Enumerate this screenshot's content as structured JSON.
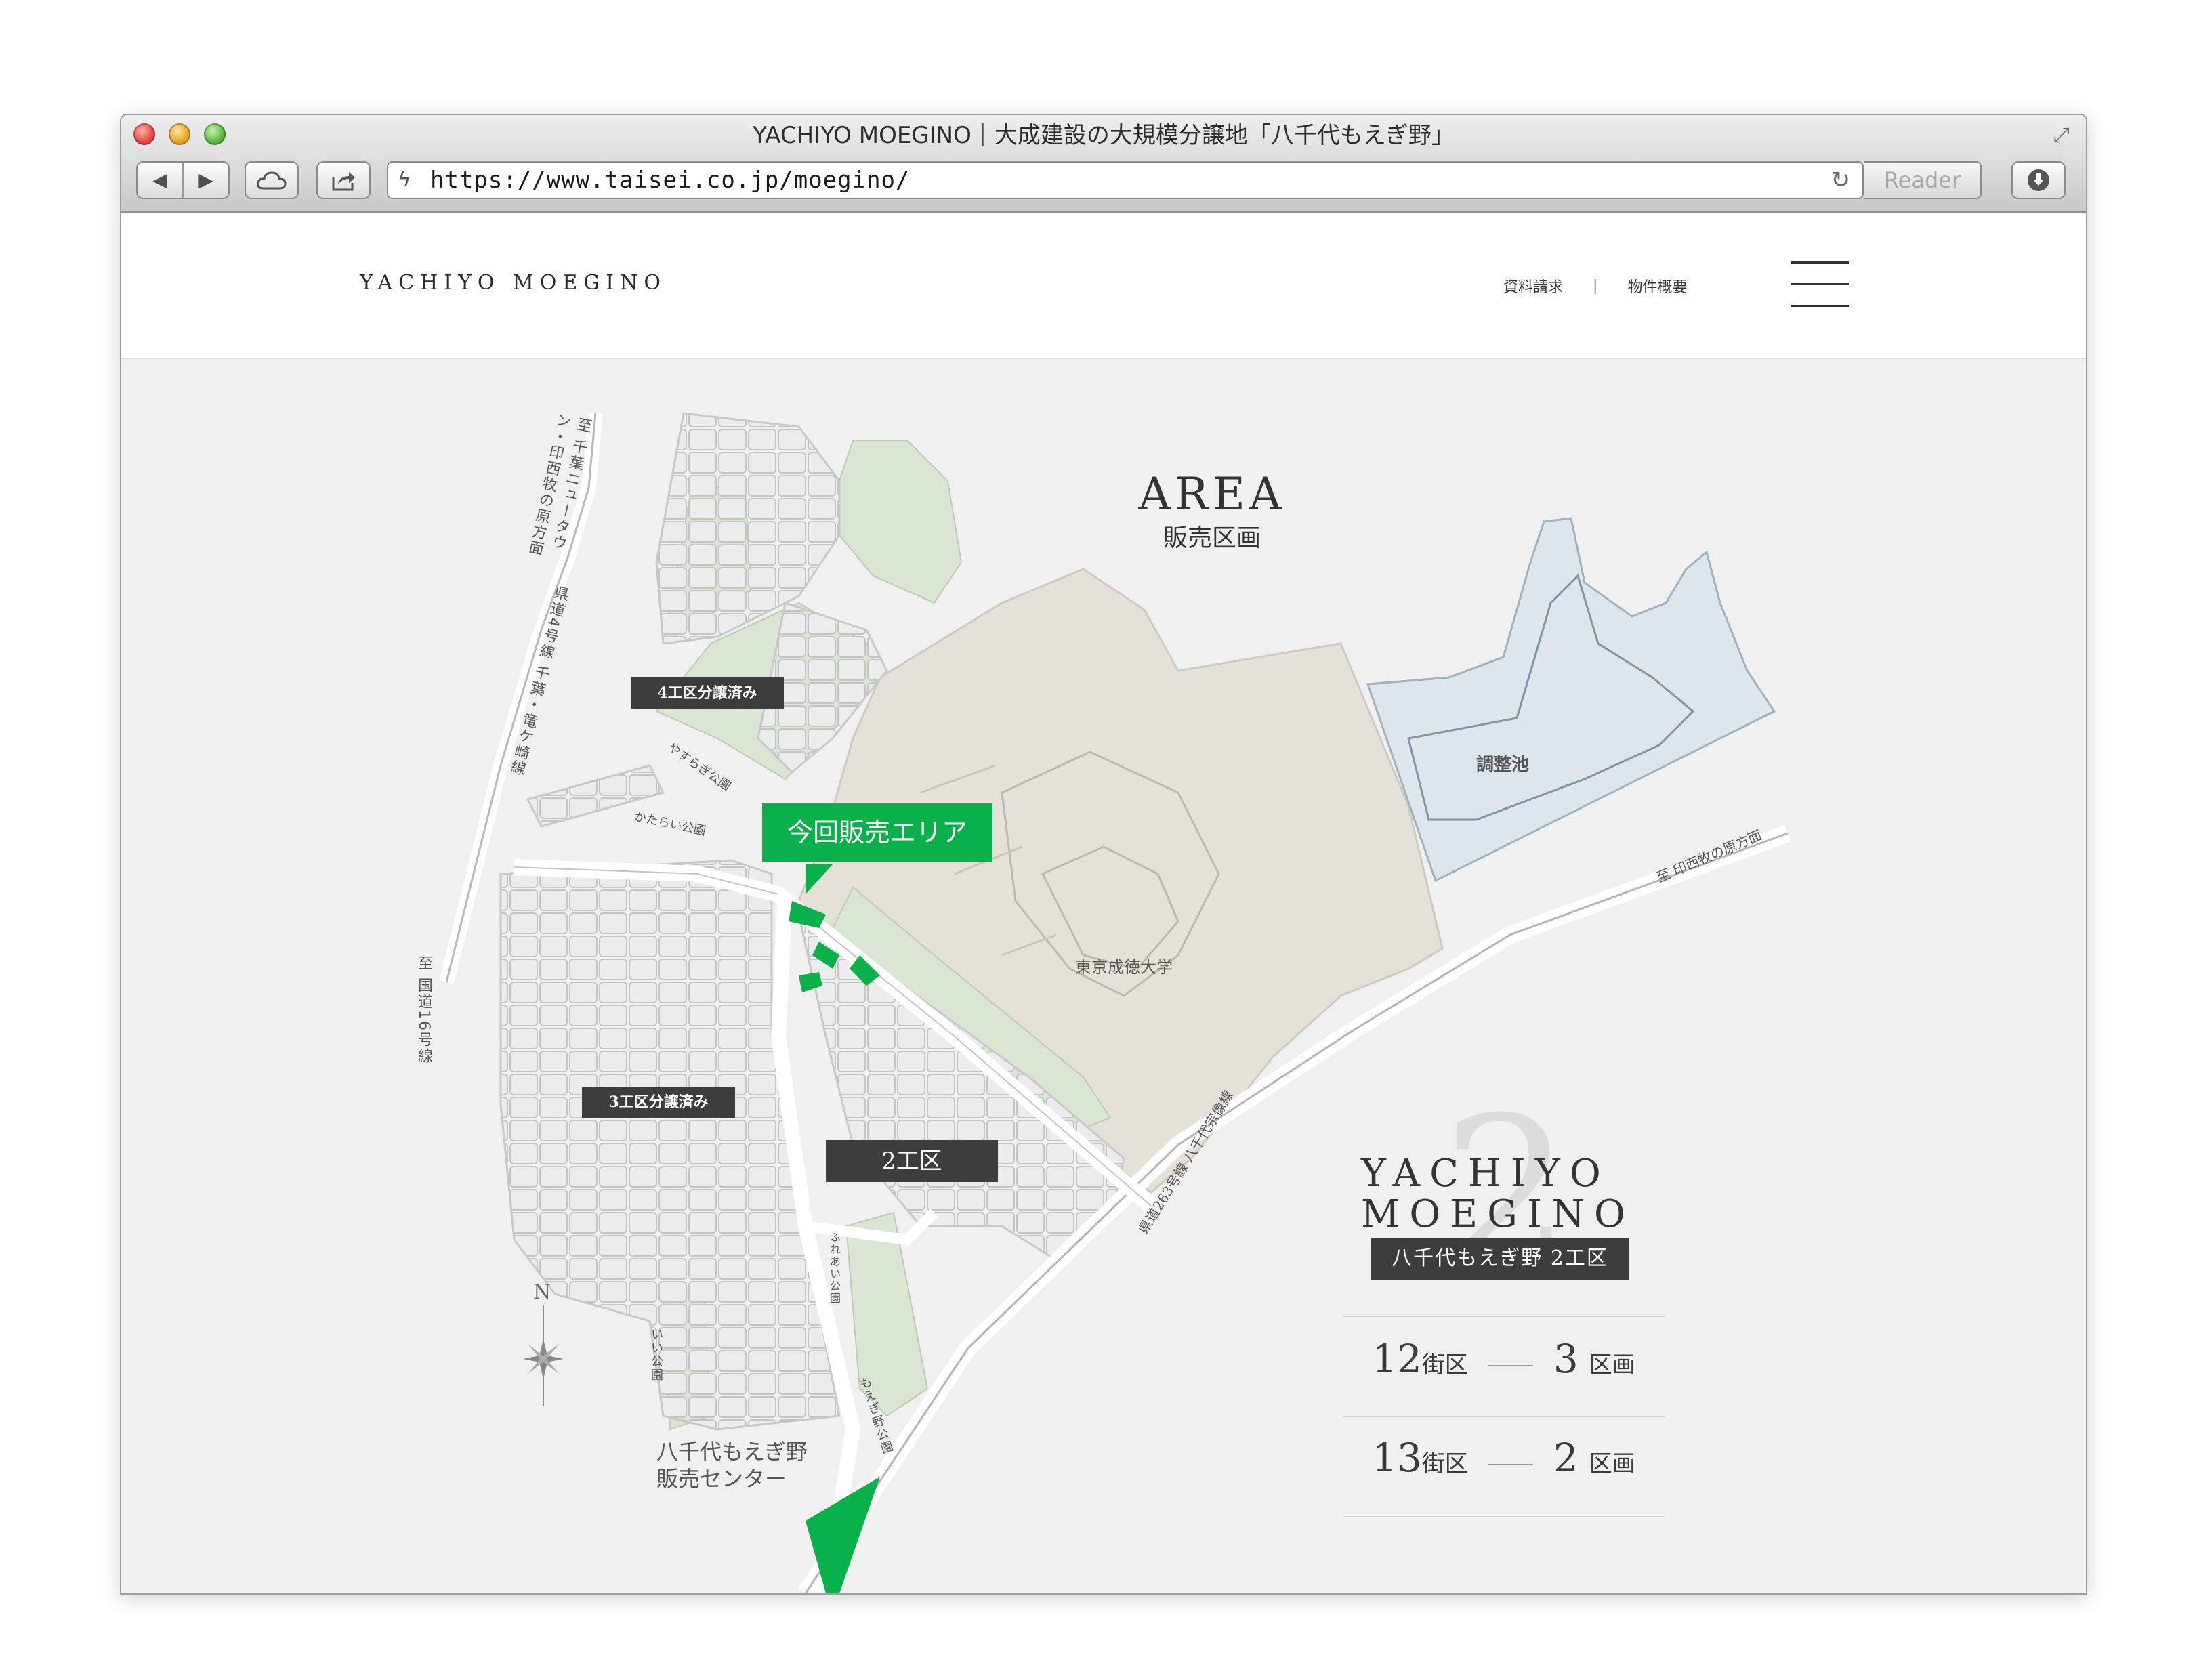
{
  "window": {
    "title": "YACHIYO MOEGINO｜大成建設の大規模分譲地「八千代もえぎ野」",
    "url": "https://www.taisei.co.jp/moegino/",
    "reader_label": "Reader"
  },
  "header": {
    "logo": "YACHIYO MOEGINO",
    "nav": [
      {
        "label": "資料請求"
      },
      {
        "label": "物件概要"
      }
    ],
    "nav_separator": "|"
  },
  "area": {
    "title_en": "AREA",
    "title_ja": "販売区画"
  },
  "map": {
    "labels": {
      "ward4": "4工区分譲済み",
      "ward3": "3工区分譲済み",
      "ward2": "2工区",
      "current_sale": "今回販売エリア",
      "university": "東京成徳大学",
      "pond": "調整池",
      "sales_center_line1": "八千代もえぎ野",
      "sales_center_line2": "販売センター",
      "park_yasuragi": "やすらぎ公園",
      "park_katarai": "かたらい公園",
      "park_fureai": "ふれあい公園",
      "park_iii": "いい公園",
      "park_moegino": "もえぎ野公園",
      "route_newtown": "至 千葉ニュータウン・印西牧の原方面",
      "route_pref4": "県道4号線 千葉・竜ケ崎線",
      "route_national16": "至 国道16号線",
      "route_inzai": "至 印西牧の原方面",
      "route_pref263": "県道263号線 八千代宗像線",
      "north": "N"
    },
    "colors": {
      "green": "#0ab04a",
      "park": "#dbe6d2",
      "university_land": "#e4e1d8",
      "pond_water": "#dce6ec",
      "dark_label": "#3d3d3d"
    }
  },
  "brand": {
    "line1": "YACHIYO",
    "line2": "MOEGINO",
    "big_number": "2",
    "tag": "八千代もえぎ野 2工区"
  },
  "stats": [
    {
      "block": "12",
      "block_unit": "街区",
      "lots": "3",
      "lots_unit": "区画"
    },
    {
      "block": "13",
      "block_unit": "街区",
      "lots": "2",
      "lots_unit": "区画"
    }
  ],
  "icons": {
    "back": "back-arrow-icon",
    "forward": "forward-arrow-icon",
    "icloud": "cloud-icon",
    "share": "share-icon",
    "secure": "lightning-icon",
    "reload": "reload-icon",
    "download": "download-icon",
    "fullscreen": "fullscreen-icon",
    "menu": "hamburger-menu-icon",
    "compass": "compass-icon"
  }
}
